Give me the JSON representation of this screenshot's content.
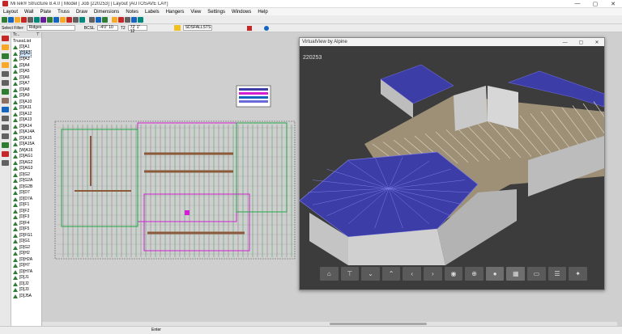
{
  "window": {
    "title": "MiTek® Structure 8.4.0 | Model | Job [220253] | Layout [AUTOSAVE LAY]",
    "minimize": "—",
    "maximize": "▢",
    "close": "✕"
  },
  "menu": [
    "Layout",
    "Wall",
    "Plate",
    "Truss",
    "Draw",
    "Dimensions",
    "Notes",
    "Labels",
    "Hangers",
    "View",
    "Settings",
    "Windows",
    "Help"
  ],
  "toolbar2": {
    "filter_label": "Select Filter:",
    "filter_value": "Ridges",
    "coord_label": "BCSL",
    "coord_value": "-4'0\" 10",
    "pitch_label": "T2",
    "pitch_value": "72' 1\" 12",
    "layer_value": "SDSFALLSTS"
  },
  "tree": {
    "header": "Tr...",
    "pin": "⊤",
    "root": "TrussList",
    "items": [
      "[D]A1",
      "[D]A2",
      "[D]A3",
      "[D]A4",
      "[D]A5",
      "[D]A6",
      "[D]A7",
      "[D]A8",
      "[D]A9",
      "[D]A10",
      "[D]A11",
      "[D]A12",
      "[D]A13",
      "[D]A14",
      "[D]A14A",
      "[D]A15",
      "[D]A15A",
      "[W]A16",
      "[D]AG1",
      "[D]AG2",
      "[D]AG3",
      "[D]G2",
      "[D]G2A",
      "[D]G2B",
      "[D]D7",
      "[D]D7A",
      "[D]F1",
      "[D]F2",
      "[D]F3",
      "[D]F4",
      "[D]F5",
      "[D]FG1",
      "[D]G1",
      "[D]G2",
      "[D]H2",
      "[D]H2A",
      "[D]H7",
      "[D]H7A",
      "[D]J1",
      "[D]J2",
      "[D]J3",
      "[D]J5A"
    ]
  },
  "virtual_view": {
    "title": "VirtualView by Alpine",
    "job": "220253",
    "buttons": [
      "home-icon",
      "top-view-icon",
      "chevron-down-icon",
      "chevron-up-icon",
      "chevron-left-icon",
      "chevron-right-icon",
      "eye-icon",
      "zoom-icon",
      "person-icon",
      "frame-icon",
      "plate-icon",
      "stack-icon",
      "walk-icon"
    ]
  },
  "legend": {
    "rows": [
      "",
      "",
      "",
      ""
    ]
  },
  "status": {
    "text": "Enter"
  },
  "colors": {
    "roof": "#3d3da8",
    "roof_light": "#6a6ad8",
    "wall": "#b9b9b9",
    "truss": "#9e9077",
    "plan_green": "#22a64a",
    "plan_magenta": "#d11fd1",
    "plan_brown": "#8a5a3b",
    "accent_red": "#c62828"
  }
}
